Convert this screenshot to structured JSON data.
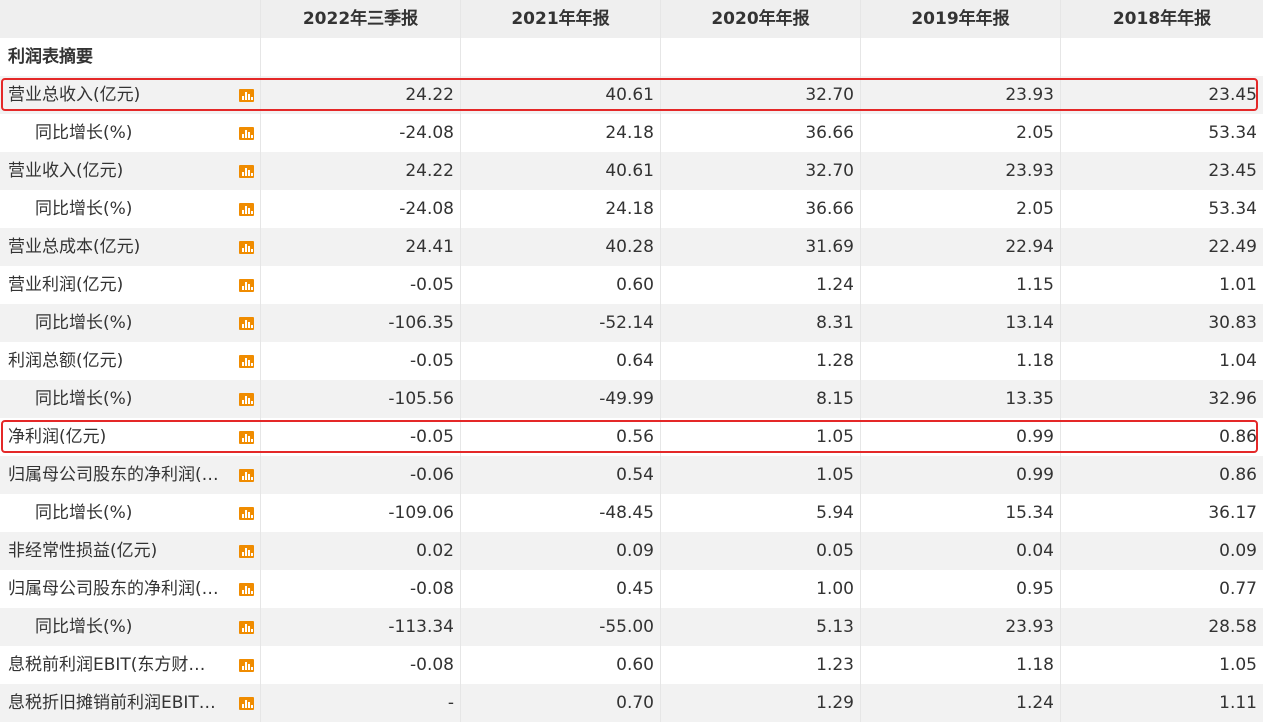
{
  "columns": [
    "2022年三季报",
    "2021年年报",
    "2020年年报",
    "2019年年报",
    "2018年年报"
  ],
  "section_title": "利润表摘要",
  "rows": [
    {
      "label": "营业总收入(亿元)",
      "indent": false,
      "values": [
        "24.22",
        "40.61",
        "32.70",
        "23.93",
        "23.45"
      ],
      "highlighted": true
    },
    {
      "label": "同比增长(%)",
      "indent": true,
      "values": [
        "-24.08",
        "24.18",
        "36.66",
        "2.05",
        "53.34"
      ]
    },
    {
      "label": "营业收入(亿元)",
      "indent": false,
      "values": [
        "24.22",
        "40.61",
        "32.70",
        "23.93",
        "23.45"
      ]
    },
    {
      "label": "同比增长(%)",
      "indent": true,
      "values": [
        "-24.08",
        "24.18",
        "36.66",
        "2.05",
        "53.34"
      ]
    },
    {
      "label": "营业总成本(亿元)",
      "indent": false,
      "values": [
        "24.41",
        "40.28",
        "31.69",
        "22.94",
        "22.49"
      ]
    },
    {
      "label": "营业利润(亿元)",
      "indent": false,
      "values": [
        "-0.05",
        "0.60",
        "1.24",
        "1.15",
        "1.01"
      ]
    },
    {
      "label": "同比增长(%)",
      "indent": true,
      "values": [
        "-106.35",
        "-52.14",
        "8.31",
        "13.14",
        "30.83"
      ]
    },
    {
      "label": "利润总额(亿元)",
      "indent": false,
      "values": [
        "-0.05",
        "0.64",
        "1.28",
        "1.18",
        "1.04"
      ]
    },
    {
      "label": "同比增长(%)",
      "indent": true,
      "values": [
        "-105.56",
        "-49.99",
        "8.15",
        "13.35",
        "32.96"
      ]
    },
    {
      "label": "净利润(亿元)",
      "indent": false,
      "values": [
        "-0.05",
        "0.56",
        "1.05",
        "0.99",
        "0.86"
      ],
      "highlighted": true
    },
    {
      "label": "归属母公司股东的净利润(…",
      "indent": false,
      "values": [
        "-0.06",
        "0.54",
        "1.05",
        "0.99",
        "0.86"
      ]
    },
    {
      "label": "同比增长(%)",
      "indent": true,
      "values": [
        "-109.06",
        "-48.45",
        "5.94",
        "15.34",
        "36.17"
      ]
    },
    {
      "label": "非经常性损益(亿元)",
      "indent": false,
      "values": [
        "0.02",
        "0.09",
        "0.05",
        "0.04",
        "0.09"
      ]
    },
    {
      "label": "归属母公司股东的净利润(…",
      "indent": false,
      "values": [
        "-0.08",
        "0.45",
        "1.00",
        "0.95",
        "0.77"
      ]
    },
    {
      "label": "同比增长(%)",
      "indent": true,
      "values": [
        "-113.34",
        "-55.00",
        "5.13",
        "23.93",
        "28.58"
      ]
    },
    {
      "label": "息税前利润EBIT(东方财…",
      "indent": false,
      "values": [
        "-0.08",
        "0.60",
        "1.23",
        "1.18",
        "1.05"
      ]
    },
    {
      "label": "息税折旧摊销前利润EBIT…",
      "indent": false,
      "values": [
        "-",
        "0.70",
        "1.29",
        "1.24",
        "1.11"
      ]
    }
  ],
  "colors": {
    "header_bg": "#efefef",
    "row_alt_bg": "#f2f2f2",
    "highlight_border": "#e42828",
    "chart_icon": "#f08c00"
  },
  "icon": "bar-chart-icon"
}
